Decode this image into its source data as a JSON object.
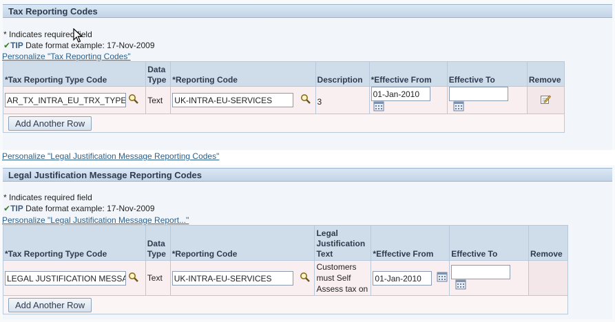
{
  "section1": {
    "title": "Tax Reporting Codes",
    "required_note": "* Indicates required field",
    "tip_label": "TIP",
    "tip_text": "Date format example: 17-Nov-2009",
    "personalize_link": "Personalize \"Tax Reporting Codes\"",
    "columns": {
      "type_code": "*Tax Reporting Type Code",
      "data_type": [
        "Data",
        "Type"
      ],
      "reporting_code": "*Reporting Code",
      "description": "Description",
      "effective_from": "*Effective From",
      "effective_to": "Effective To",
      "remove": "Remove"
    },
    "row": {
      "type_code": "AR_TX_INTRA_EU_TRX_TYPE",
      "data_type": "Text",
      "reporting_code": "UK-INTRA-EU-SERVICES",
      "description": "3",
      "effective_from": "01-Jan-2010",
      "effective_to": ""
    },
    "add_row_label": "Add Another Row"
  },
  "personalize_legal_link": "Personalize \"Legal Justification Message Reporting Codes\"",
  "section2": {
    "title": "Legal Justification Message Reporting Codes",
    "required_note": "* Indicates required field",
    "tip_label": "TIP",
    "tip_text": "Date format example: 17-Nov-2009",
    "personalize_link": "Personalize \"Legal Justification Message Report...\"",
    "columns": {
      "type_code": "*Tax Reporting Type Code",
      "data_type": [
        "Data",
        "Type"
      ],
      "reporting_code": "*Reporting Code",
      "legal_text": [
        "Legal",
        "Justification",
        "Text"
      ],
      "effective_from": "*Effective From",
      "effective_to": "Effective To",
      "remove": "Remove"
    },
    "row": {
      "type_code": "LEGAL JUSTIFICATION MESSA",
      "data_type": "Text",
      "reporting_code": "UK-INTRA-EU-SERVICES",
      "legal_text": [
        "Customers",
        "must Self",
        "Assess tax on"
      ],
      "effective_from": "01-Jan-2010",
      "effective_to": ""
    },
    "add_row_label": "Add Another Row"
  },
  "icons": {
    "search": "magnifier-icon",
    "calendar": "calendar-icon",
    "remove": "remove-row-icon",
    "tip": "checkmark-icon",
    "cursor": "mouse-cursor"
  }
}
